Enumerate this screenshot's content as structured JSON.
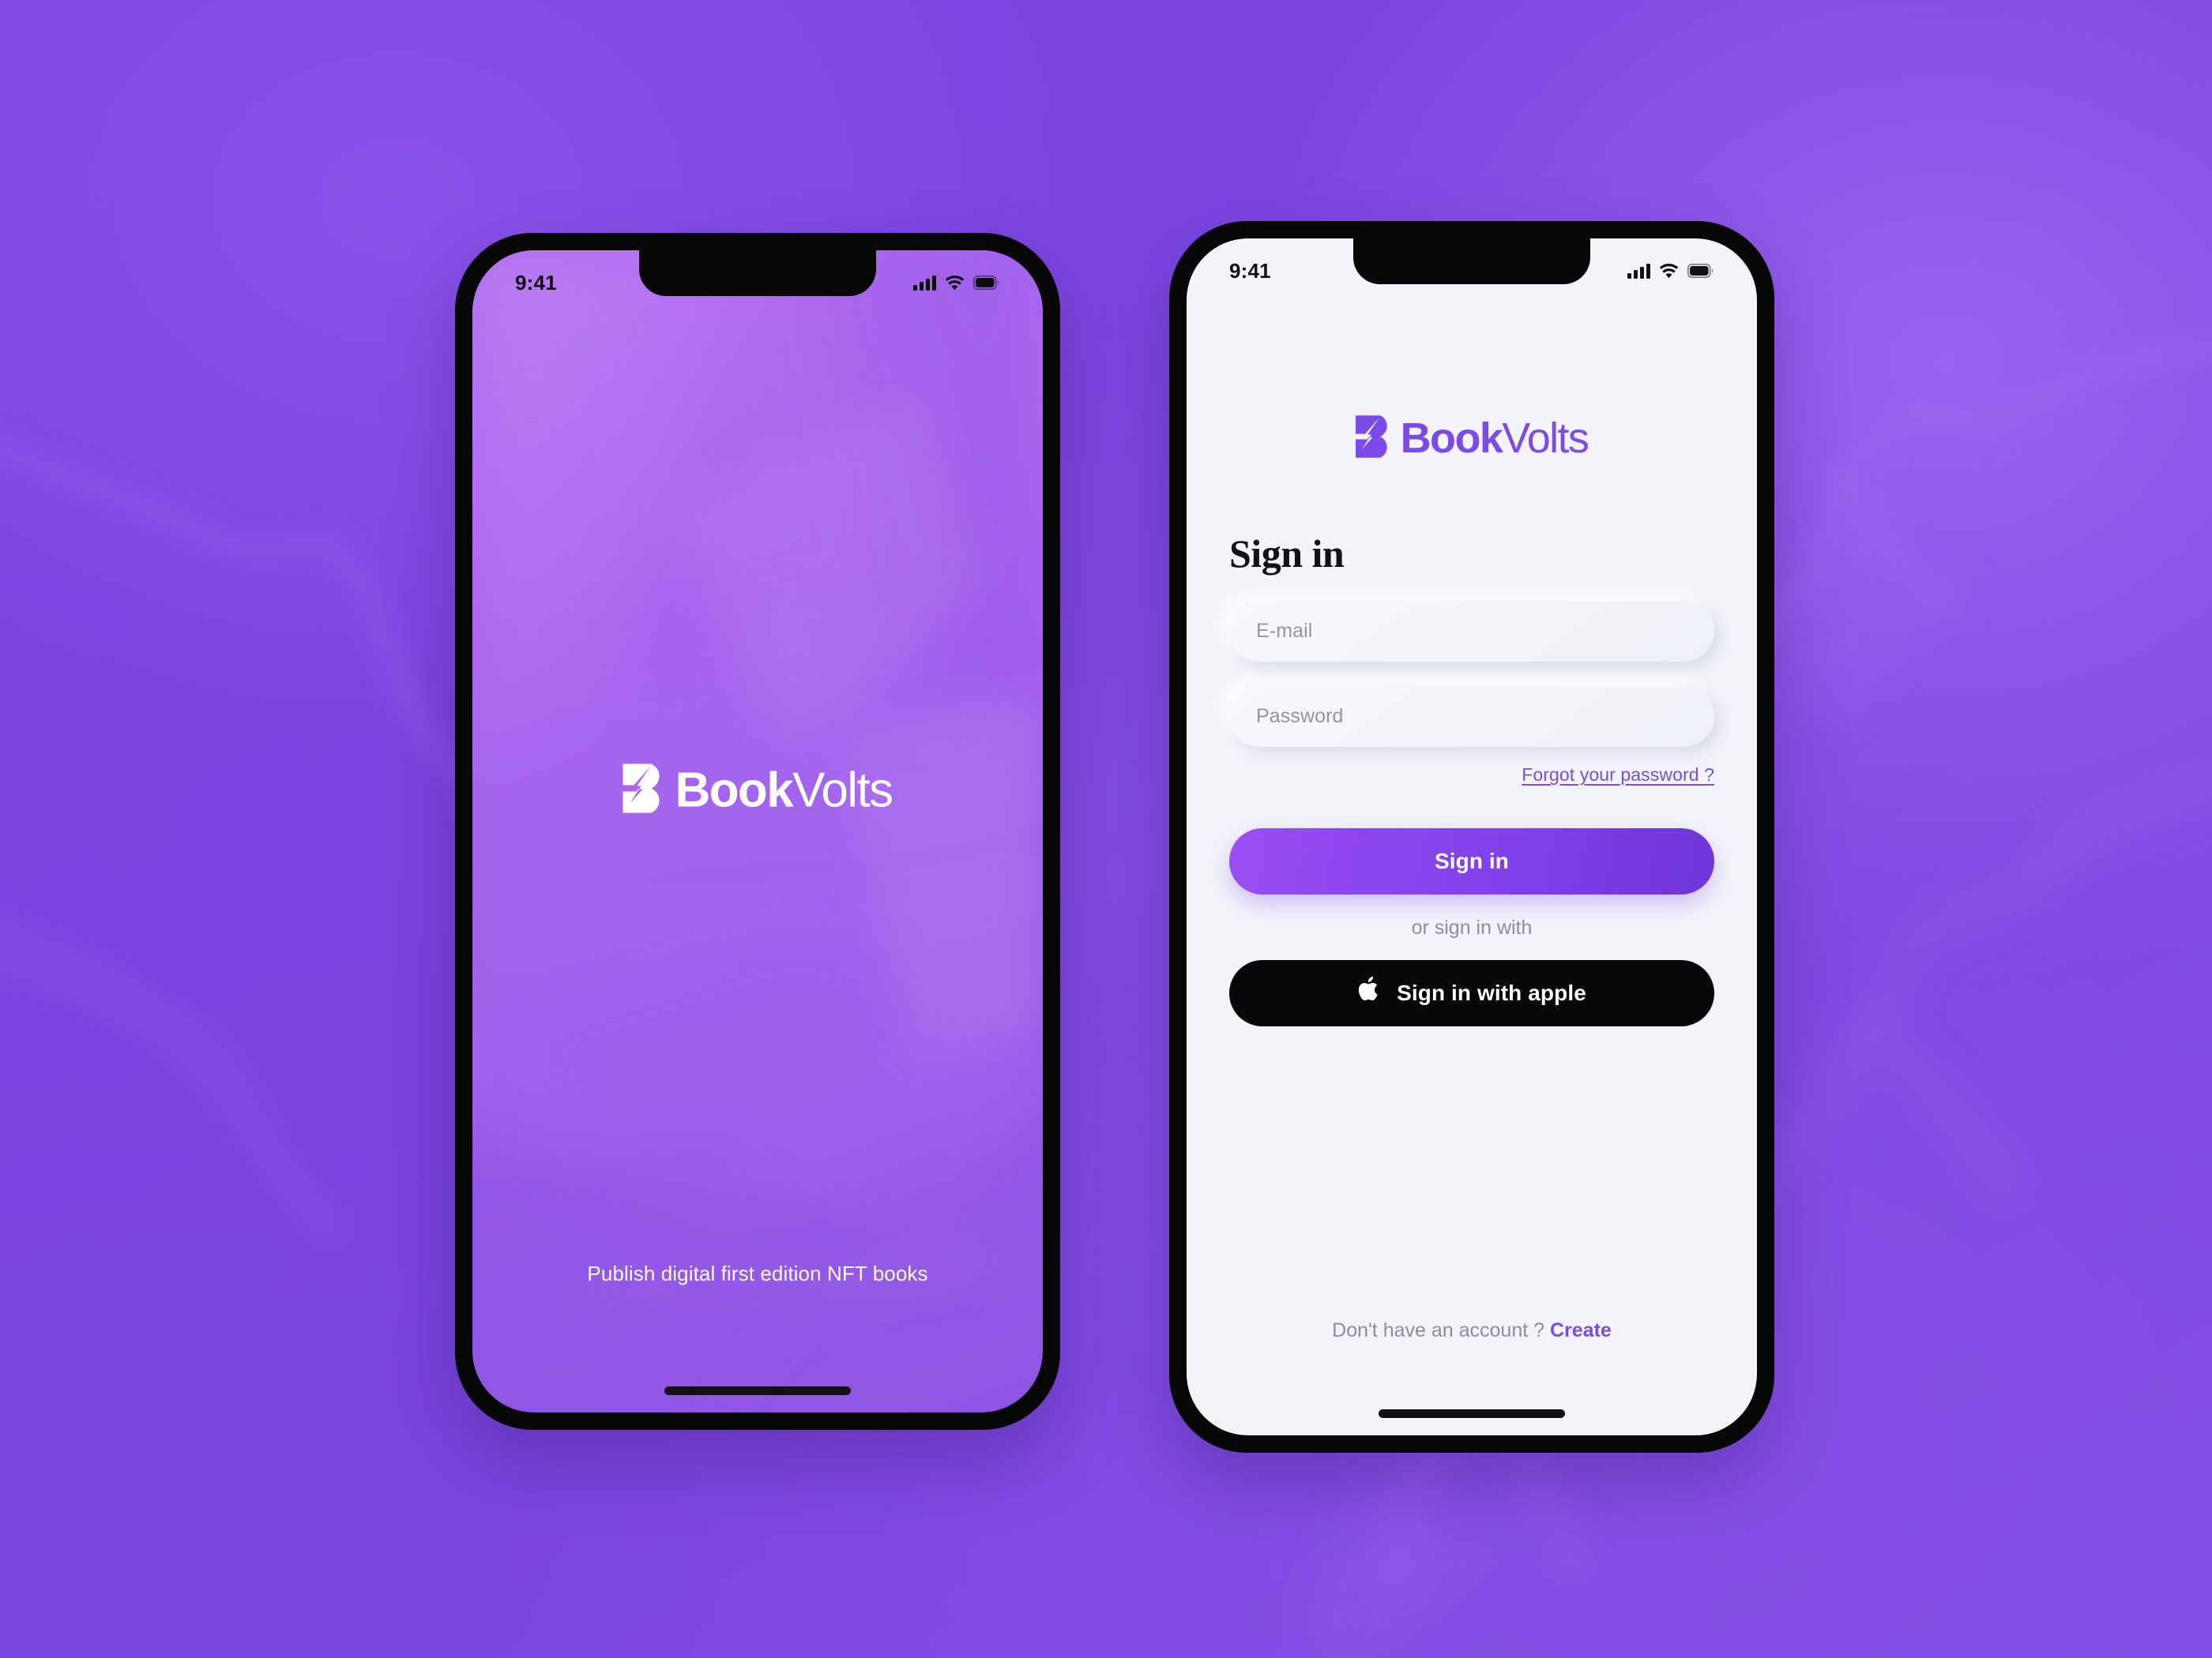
{
  "theme": {
    "brand_purple": "#7C4AE8",
    "brand_purple_light": "#9B4FF2",
    "brand_purple_deep": "#6F36D9",
    "screen_bg": "#F3F4FA",
    "splash_purple": "#A963EE",
    "page_bg": "#7C45E0",
    "black": "#08080A"
  },
  "brand": {
    "name_bold": "Book",
    "name_regular": "Volts",
    "logo_mark": "b-lightning-bolt-icon"
  },
  "status_bar": {
    "time": "9:41",
    "signal_icon": "cellular-signal-icon",
    "wifi_icon": "wifi-icon",
    "battery_icon": "battery-icon"
  },
  "splash_screen": {
    "tagline": "Publish digital first edition NFT books",
    "home_indicator": "home-indicator"
  },
  "signin_screen": {
    "title": "Sign in",
    "email_field": {
      "placeholder": "E-mail",
      "value": ""
    },
    "password_field": {
      "placeholder": "Password",
      "value": ""
    },
    "forgot_password_label": "Forgot your password ?",
    "submit_label": "Sign in",
    "divider_label": "or sign in with",
    "apple_button": {
      "label": "Sign in with apple",
      "icon": "apple-logo-icon"
    },
    "signup_prompt": "Don't have an account ?",
    "signup_link_label": "Create",
    "home_indicator": "home-indicator"
  }
}
